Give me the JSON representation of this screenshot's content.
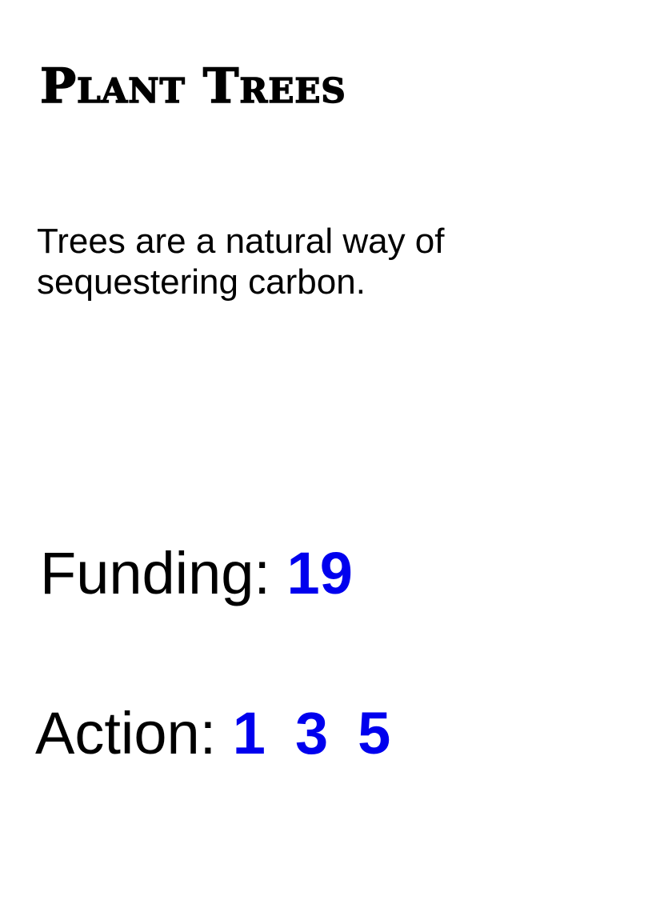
{
  "card": {
    "title": "Plant Trees",
    "description": "Trees are a natural way of sequestering carbon.",
    "funding": {
      "label": "Funding:",
      "value": "19"
    },
    "action": {
      "label": "Action:",
      "values": [
        "1",
        "3",
        "5"
      ]
    }
  },
  "colors": {
    "text": "#000000",
    "value_accent": "#0000ee",
    "background": "#ffffff"
  }
}
